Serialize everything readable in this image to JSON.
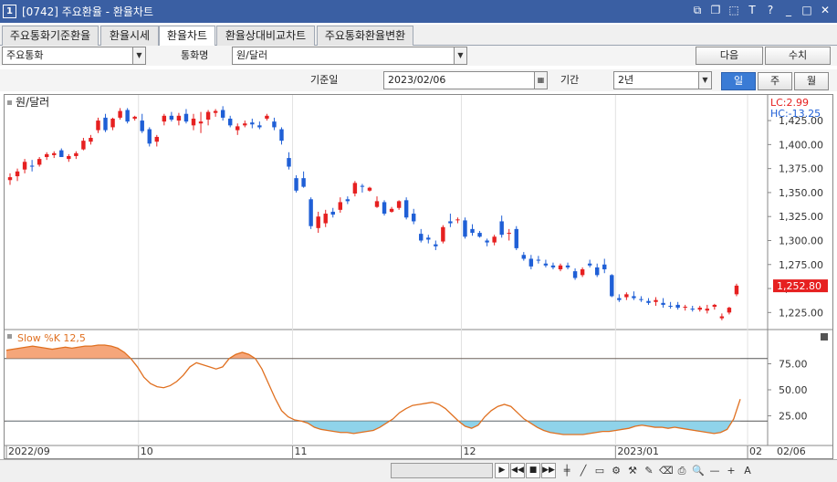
{
  "window": {
    "number": "1",
    "title": "[0742] 주요환율 - 환율차트"
  },
  "tabs": [
    {
      "label": "주요통화기준환율"
    },
    {
      "label": "환율시세"
    },
    {
      "label": "환율차트",
      "active": true
    },
    {
      "label": "환율상대비교차트"
    },
    {
      "label": "주요통화환율변환"
    }
  ],
  "controls": {
    "category": "주요통화",
    "currency_label": "통화명",
    "currency": "원/달러",
    "next_button": "다음",
    "values_button": "수치",
    "base_date_label": "기준일",
    "base_date": "2023/02/06",
    "period_label": "기간",
    "period": "2년",
    "period_buttons": [
      "일",
      "주",
      "월"
    ]
  },
  "chart_data": [
    {
      "type": "candlestick",
      "title": "원/달러",
      "lc_label": "LC:2.99",
      "hc_label": "HC:-13.25",
      "y_ticks": [
        "1,425.00",
        "1,400.00",
        "1,375.00",
        "1,350.00",
        "1,325.00",
        "1,300.00",
        "1,275.00",
        "1,250.00",
        "1,225.00"
      ],
      "ylim": [
        1212,
        1446
      ],
      "last_value_label": "1,252.80",
      "last_value": 1252.8,
      "x_labels": [
        "2022/09",
        "10",
        "11",
        "12",
        "2023/01",
        "02"
      ],
      "right_date_label": "02/06",
      "colors": {
        "up": "#e62020",
        "down": "#1f5fd6"
      },
      "ohlc": [
        [
          1363,
          1370,
          1358,
          1366
        ],
        [
          1367,
          1375,
          1362,
          1372
        ],
        [
          1374,
          1385,
          1370,
          1382
        ],
        [
          1378,
          1384,
          1372,
          1377
        ],
        [
          1379,
          1387,
          1377,
          1385
        ],
        [
          1387,
          1392,
          1384,
          1390
        ],
        [
          1389,
          1393,
          1386,
          1391
        ],
        [
          1394,
          1396,
          1387,
          1387
        ],
        [
          1385,
          1390,
          1382,
          1388
        ],
        [
          1388,
          1393,
          1385,
          1391
        ],
        [
          1395,
          1407,
          1394,
          1404
        ],
        [
          1403,
          1410,
          1400,
          1407
        ],
        [
          1415,
          1428,
          1412,
          1425
        ],
        [
          1428,
          1432,
          1413,
          1415
        ],
        [
          1418,
          1428,
          1415,
          1427
        ],
        [
          1428,
          1438,
          1426,
          1435
        ],
        [
          1436,
          1438,
          1422,
          1424
        ],
        [
          1427,
          1430,
          1425,
          1429
        ],
        [
          1425,
          1432,
          1412,
          1414
        ],
        [
          1416,
          1418,
          1398,
          1401
        ],
        [
          1403,
          1410,
          1398,
          1408
        ],
        [
          1424,
          1432,
          1420,
          1430
        ],
        [
          1430,
          1434,
          1424,
          1426
        ],
        [
          1425,
          1433,
          1420,
          1430
        ],
        [
          1432,
          1437,
          1422,
          1424
        ],
        [
          1420,
          1432,
          1415,
          1427
        ],
        [
          1422,
          1434,
          1412,
          1424
        ],
        [
          1426,
          1436,
          1420,
          1434
        ],
        [
          1433,
          1437,
          1429,
          1435
        ],
        [
          1436,
          1440,
          1425,
          1428
        ],
        [
          1427,
          1430,
          1418,
          1420
        ],
        [
          1415,
          1422,
          1410,
          1419
        ],
        [
          1420,
          1425,
          1418,
          1422
        ],
        [
          1423,
          1427,
          1417,
          1421
        ],
        [
          1420,
          1424,
          1416,
          1418
        ],
        [
          1427,
          1432,
          1425,
          1430
        ],
        [
          1424,
          1428,
          1415,
          1418
        ],
        [
          1416,
          1418,
          1400,
          1404
        ],
        [
          1386,
          1392,
          1374,
          1377
        ],
        [
          1365,
          1368,
          1350,
          1352
        ],
        [
          1365,
          1372,
          1355,
          1356
        ],
        [
          1343,
          1345,
          1312,
          1315
        ],
        [
          1313,
          1330,
          1308,
          1325
        ],
        [
          1318,
          1332,
          1314,
          1328
        ],
        [
          1330,
          1334,
          1324,
          1327
        ],
        [
          1332,
          1345,
          1329,
          1340
        ],
        [
          1343,
          1346,
          1338,
          1341
        ],
        [
          1349,
          1362,
          1346,
          1360
        ],
        [
          1357,
          1359,
          1350,
          1356
        ],
        [
          1352,
          1356,
          1351,
          1355
        ],
        [
          1335,
          1346,
          1334,
          1341
        ],
        [
          1340,
          1342,
          1326,
          1328
        ],
        [
          1330,
          1335,
          1329,
          1333
        ],
        [
          1334,
          1342,
          1332,
          1341
        ],
        [
          1342,
          1345,
          1322,
          1324
        ],
        [
          1328,
          1333,
          1317,
          1320
        ],
        [
          1307,
          1312,
          1298,
          1300
        ],
        [
          1303,
          1306,
          1297,
          1301
        ],
        [
          1296,
          1300,
          1290,
          1294
        ],
        [
          1299,
          1316,
          1297,
          1314
        ],
        [
          1320,
          1328,
          1314,
          1318
        ],
        [
          1322,
          1324,
          1318,
          1322
        ],
        [
          1321,
          1324,
          1302,
          1304
        ],
        [
          1312,
          1317,
          1305,
          1308
        ],
        [
          1308,
          1310,
          1303,
          1304
        ],
        [
          1300,
          1302,
          1294,
          1298
        ],
        [
          1298,
          1306,
          1295,
          1304
        ],
        [
          1320,
          1326,
          1303,
          1306
        ],
        [
          1307,
          1312,
          1300,
          1308
        ],
        [
          1312,
          1315,
          1290,
          1292
        ],
        [
          1285,
          1288,
          1279,
          1281
        ],
        [
          1281,
          1285,
          1270,
          1273
        ],
        [
          1280,
          1284,
          1276,
          1279
        ],
        [
          1276,
          1280,
          1272,
          1274
        ],
        [
          1274,
          1277,
          1270,
          1272
        ],
        [
          1270,
          1276,
          1268,
          1274
        ],
        [
          1274,
          1277,
          1270,
          1272
        ],
        [
          1268,
          1271,
          1259,
          1261
        ],
        [
          1264,
          1272,
          1262,
          1270
        ],
        [
          1276,
          1280,
          1272,
          1274
        ],
        [
          1272,
          1276,
          1262,
          1264
        ],
        [
          1275,
          1281,
          1266,
          1270
        ],
        [
          1264,
          1265,
          1241,
          1242
        ],
        [
          1240,
          1244,
          1236,
          1238
        ],
        [
          1241,
          1246,
          1238,
          1244
        ],
        [
          1242,
          1247,
          1238,
          1240
        ],
        [
          1239,
          1242,
          1236,
          1238
        ],
        [
          1237,
          1240,
          1233,
          1235
        ],
        [
          1236,
          1241,
          1232,
          1238
        ],
        [
          1235,
          1240,
          1230,
          1233
        ],
        [
          1232,
          1236,
          1229,
          1231
        ],
        [
          1233,
          1236,
          1228,
          1230
        ],
        [
          1230,
          1233,
          1227,
          1231
        ],
        [
          1229,
          1232,
          1226,
          1228
        ],
        [
          1228,
          1232,
          1226,
          1230
        ],
        [
          1227,
          1233,
          1224,
          1229
        ],
        [
          1231,
          1234,
          1228,
          1233
        ],
        [
          1219,
          1224,
          1217,
          1221
        ],
        [
          1225,
          1231,
          1223,
          1230
        ],
        [
          1244,
          1255,
          1242,
          1253
        ]
      ]
    },
    {
      "type": "line",
      "title": "Slow %K 12,5",
      "y_ticks": [
        "75.00",
        "50.00",
        "25.00"
      ],
      "ylim": [
        0,
        100
      ],
      "upper_band": 80,
      "lower_band": 20,
      "colors": {
        "line": "#e07020",
        "overbought_fill": "#f5a67a",
        "oversold_fill": "#8fd3ea"
      },
      "values": [
        88,
        89,
        90,
        91,
        92,
        91,
        90,
        89,
        90,
        91,
        90,
        91,
        92,
        92,
        93,
        93,
        92,
        90,
        86,
        80,
        72,
        62,
        56,
        53,
        52,
        54,
        58,
        64,
        72,
        76,
        74,
        72,
        70,
        72,
        80,
        84,
        86,
        84,
        80,
        70,
        56,
        42,
        30,
        24,
        21,
        20,
        18,
        14,
        12,
        11,
        10,
        9,
        9,
        8,
        9,
        10,
        11,
        14,
        18,
        22,
        28,
        32,
        35,
        36,
        37,
        38,
        36,
        32,
        26,
        20,
        15,
        13,
        16,
        24,
        30,
        34,
        36,
        34,
        28,
        22,
        18,
        14,
        11,
        9,
        8,
        7,
        7,
        7,
        7,
        8,
        9,
        10,
        10,
        11,
        12,
        13,
        15,
        16,
        15,
        14,
        14,
        13,
        14,
        13,
        12,
        11,
        10,
        9,
        8,
        9,
        12,
        22,
        41
      ]
    }
  ],
  "bottom_toolbar": {
    "nav": [
      "▶",
      "◀◀",
      "■",
      "▶▶"
    ],
    "tools": [
      "🔍",
      "—",
      "+",
      "A"
    ]
  }
}
